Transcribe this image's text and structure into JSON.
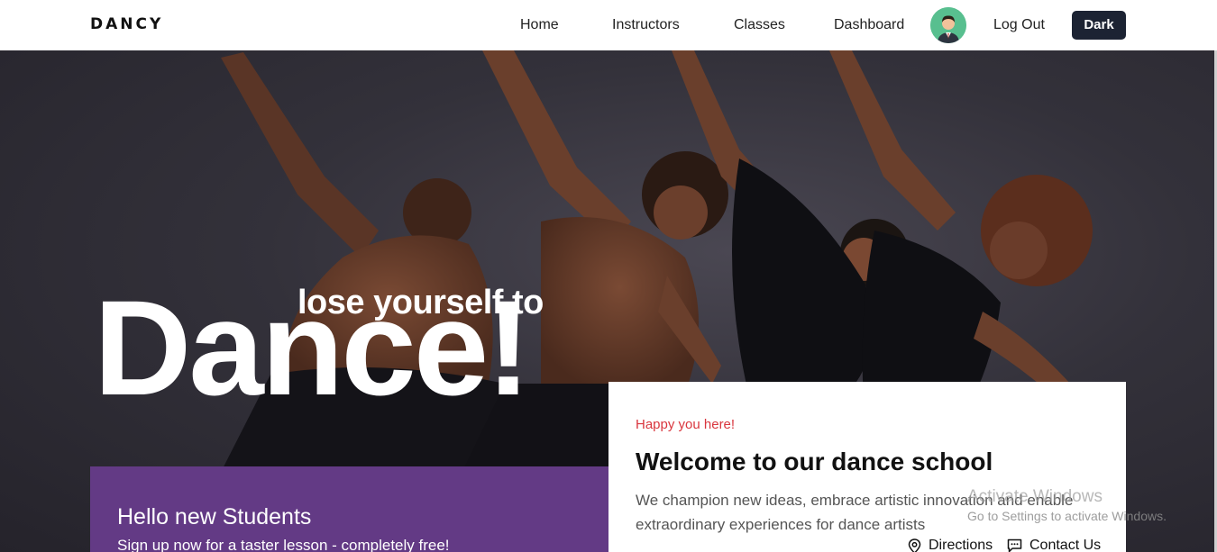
{
  "nav": {
    "logo": "DANCY",
    "links": [
      "Home",
      "Instructors",
      "Classes",
      "Dashboard"
    ],
    "logout": "Log Out",
    "theme_toggle": "Dark",
    "avatar_icon": "user-avatar-icon"
  },
  "hero": {
    "tagline": "lose yourself to",
    "headline": "Dance!"
  },
  "promo_card": {
    "title": "Hello new Students",
    "subtitle": "Sign up now for a taster lesson - completely free!",
    "color": "#633a85"
  },
  "welcome_card": {
    "kicker": "Happy you here!",
    "title": "Welcome to our dance school",
    "body": "We champion new ideas, embrace artistic innovation and enable extraordinary experiences for dance artists",
    "directions": "Directions",
    "contact": "Contact Us",
    "accent": "#d9363e"
  },
  "watermark": {
    "title": "Activate Windows",
    "subtitle": "Go to Settings to activate Windows."
  }
}
